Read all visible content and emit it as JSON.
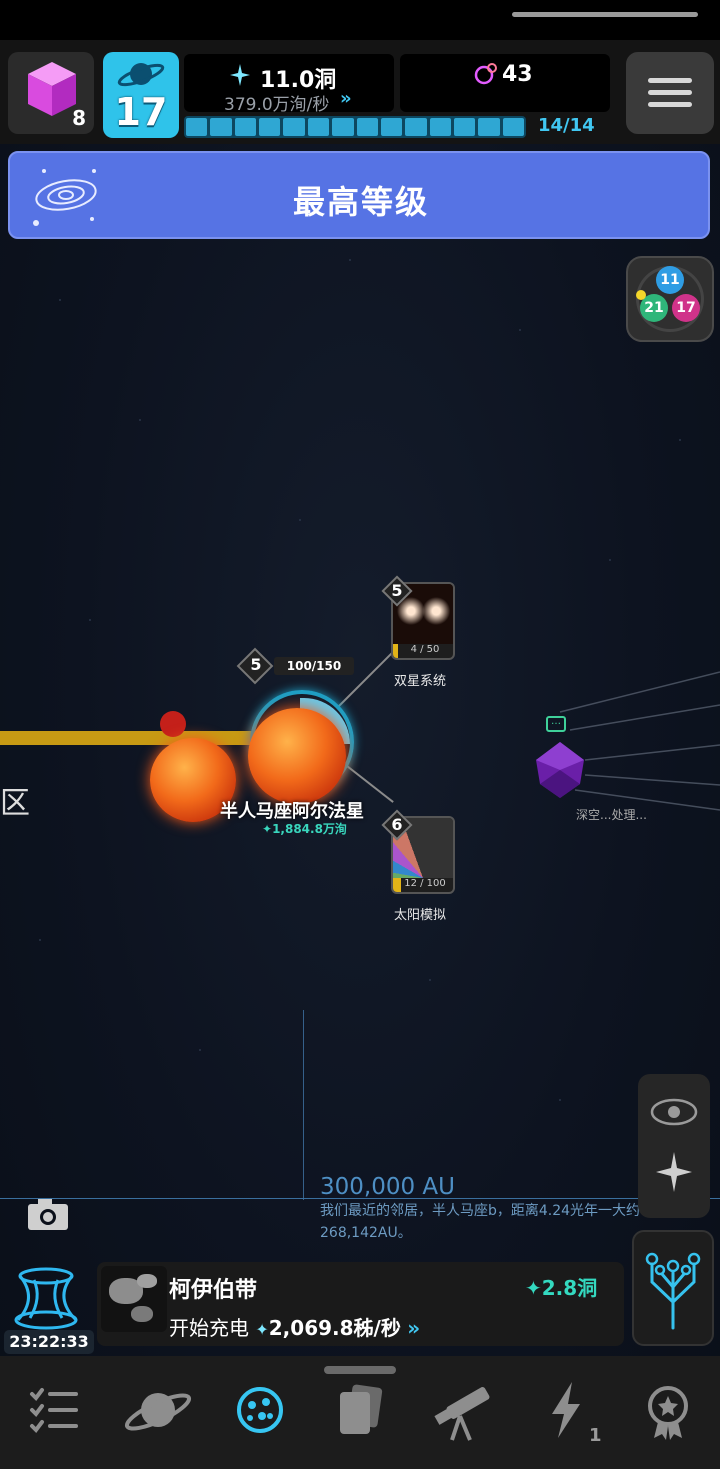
{
  "header": {
    "cube_count": "8",
    "level": "17",
    "currency_main": "11.0洞",
    "currency_rate": "379.0万洵/秒",
    "particles": "43",
    "progress_label": "14/14",
    "progress_fraction": 1.0
  },
  "banner": {
    "title": "最高等级"
  },
  "groups": {
    "bubbles": [
      "11",
      "21",
      "17"
    ]
  },
  "map": {
    "star": {
      "name": "半人马座阿尔法星",
      "value": "1,884.8万洵",
      "level": "5",
      "progress": "100/150"
    },
    "nodes": [
      {
        "name": "双星系统",
        "level": "5",
        "count": "4 / 50",
        "fill": 0.08
      },
      {
        "name": "太阳模拟",
        "level": "6",
        "count": "12 / 100",
        "fill": 0.12
      }
    ],
    "zone_label": "区",
    "deep_label": "深空...处理...",
    "scale_label": "300,000 AU",
    "scale_desc": "我们最近的邻居，半人马座b，距离4.24光年一大约268,142AU。"
  },
  "event": {
    "timer": "23:22:33",
    "name": "柯伊伯带",
    "reward": "2.8洞",
    "status_prefix": "开始充电",
    "status_rate": "2,069.8秭/秒"
  },
  "nav": {
    "items": [
      "tasks",
      "planets",
      "star-systems",
      "cards",
      "research",
      "boosts",
      "achievements"
    ],
    "boost_badge": "1"
  },
  "colors": {
    "accent": "#2fc3ea",
    "banner": "#5673e4",
    "teal": "#34d9c0",
    "laser": "#c79a14"
  }
}
